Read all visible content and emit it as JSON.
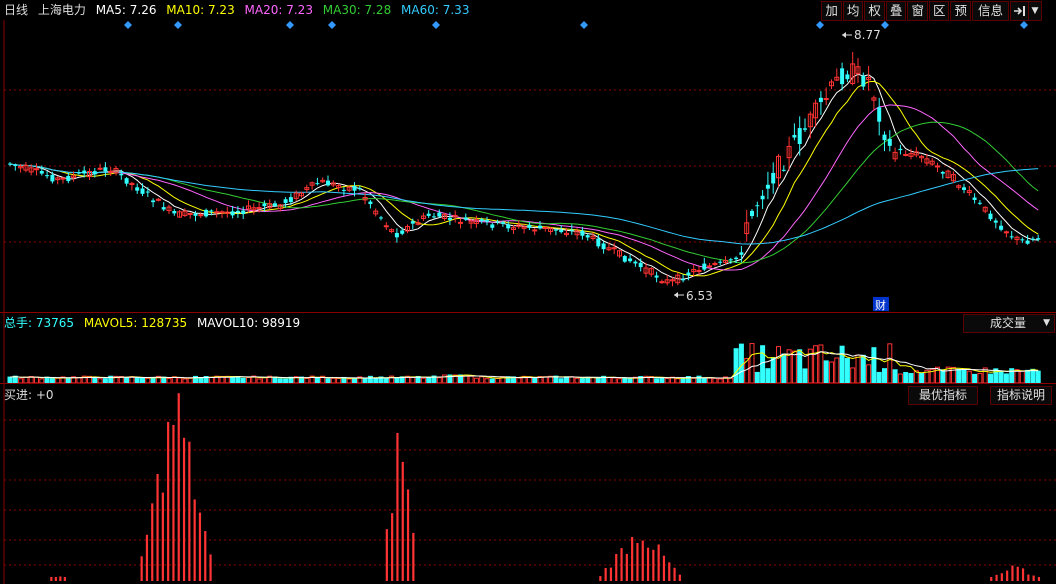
{
  "header": {
    "period": "日线",
    "stock_name": "上海电力",
    "ma5": "MA5: 7.26",
    "ma10": "MA10: 7.23",
    "ma20": "MA20: 7.23",
    "ma30": "MA30: 7.28",
    "ma60": "MA60: 7.33"
  },
  "toolbar": {
    "items": [
      "加",
      "均",
      "权",
      "叠",
      "窗",
      "区",
      "预",
      "信息"
    ],
    "collapse_icon": "exit-arrow-icon",
    "dropdown_icon": "triangle-down-icon"
  },
  "price_chart": {
    "high_label": "8.77",
    "low_label": "6.53",
    "finance_marker": "财"
  },
  "volume_panel": {
    "total": "总手: 73765",
    "mavol5": "MAVOL5: 128735",
    "mavol10": "MAVOL10: 98919",
    "selector": "成交量"
  },
  "indicator_panel": {
    "label": "买进: +0",
    "best_button": "最优指标",
    "help_button": "指标说明"
  },
  "colors": {
    "up": "#ff3333",
    "down": "#33ffff",
    "ma5": "#ffffff",
    "ma10": "#ffff00",
    "ma20": "#ff66ff",
    "ma30": "#33cc33",
    "ma60": "#33ccff",
    "grid": "#8a0000"
  }
}
